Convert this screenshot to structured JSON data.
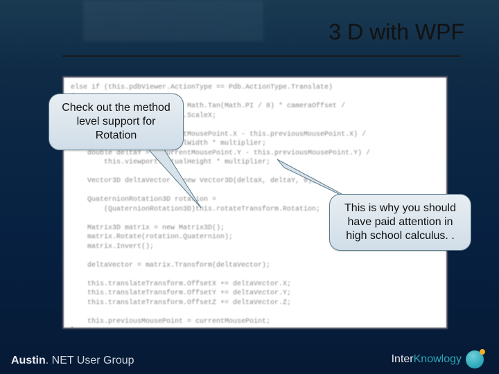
{
  "title": "3 D with WPF",
  "code": "else if (this.pdbViewer.ActionType == Pdb.ActionType.Translate)\n{\n    double multiplier = 2 * Math.Tan(Math.PI / 8) * cameraOffset /\n        this.scaleTransform.ScaleX;\n\n    double deltaX = (currentMousePoint.X - this.previousMousePoint.X) /\n        this.viewport.ActualWidth * multiplier;\n    double deltaY = -(currentMousePoint.Y - this.previousMousePoint.Y) /\n        this.viewport.ActualHeight * multiplier;\n\n    Vector3D deltaVector = new Vector3D(deltaX, deltaY, 0);\n\n    QuaternionRotation3D rotation =\n        (QuaternionRotation3D)this.rotateTransform.Rotation;\n\n    Matrix3D matrix = new Matrix3D();\n    matrix.Rotate(rotation.Quaternion);\n    matrix.Invert();\n\n    deltaVector = matrix.Transform(deltaVector);\n\n    this.translateTransform.OffsetX += deltaVector.X;\n    this.translateTransform.OffsetY += deltaVector.Y;\n    this.translateTransform.OffsetZ += deltaVector.Z;\n\n    this.previousMousePoint = currentMousePoint;\n}",
  "callouts": {
    "rotation": "Check out the method level support for Rotation",
    "calculus": "This is why you should have paid attention in high school calculus. ."
  },
  "footer": {
    "group_left": "Austin",
    "group_right": ". NET User Group",
    "company_a": "Inter",
    "company_b": "Knowlogy"
  }
}
